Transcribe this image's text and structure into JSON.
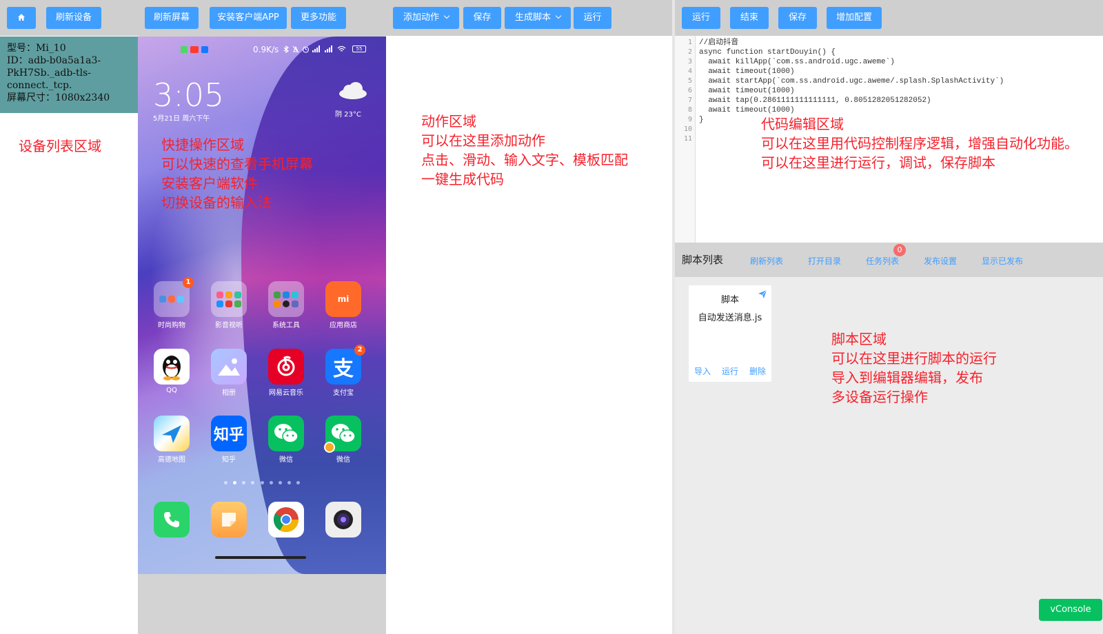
{
  "device_panel": {
    "refresh_label": "刷新设备",
    "device": {
      "model_line": "型号：Mi_10",
      "id_line1": "ID：adb-b0a5a1a3-",
      "id_line2": "PkH7Sb._adb-tls-",
      "id_line3": "connect._tcp.",
      "screen_line": "屏幕尺寸：1080x2340"
    },
    "annotation": "设备列表区域"
  },
  "quick_panel": {
    "buttons": {
      "refresh_screen": "刷新屏幕",
      "install_app": "安装客户端APP",
      "more": "更多功能"
    },
    "annotation": [
      "快捷操作区域",
      "可以快速的查看手机屏幕",
      "安装客户端软件",
      "切换设备的输入法"
    ],
    "phone": {
      "network_speed": "0.9K/s",
      "battery": "55",
      "clock": "3:05",
      "date": "5月21日 周六下午",
      "weather": "阴  23°C",
      "apps_row1": [
        {
          "label": "时尚购物",
          "badge": "1"
        },
        {
          "label": "影音视听",
          "badge": ""
        },
        {
          "label": "系统工具",
          "badge": ""
        },
        {
          "label": "应用商店",
          "badge": ""
        }
      ],
      "apps_row2": [
        {
          "label": "QQ",
          "badge": ""
        },
        {
          "label": "相册",
          "badge": ""
        },
        {
          "label": "网易云音乐",
          "badge": ""
        },
        {
          "label": "支付宝",
          "badge": "2"
        }
      ],
      "apps_row3": [
        {
          "label": "高德地图",
          "badge": ""
        },
        {
          "label": "知乎",
          "badge": ""
        },
        {
          "label": "微信",
          "badge": ""
        },
        {
          "label": "微信",
          "badge": ""
        }
      ],
      "zhihu_icon_text": "知乎",
      "alipay_icon_text": "支",
      "mi_icon_text": "mi"
    }
  },
  "action_panel": {
    "buttons": {
      "add_action": "添加动作",
      "save": "保存",
      "generate": "生成脚本",
      "run": "运行"
    },
    "annotation": [
      "动作区域",
      "可以在这里添加动作",
      "点击、滑动、输入文字、模板匹配",
      "一键生成代码"
    ]
  },
  "editor_panel": {
    "buttons": {
      "run": "运行",
      "stop": "结束",
      "save": "保存",
      "add_config": "增加配置"
    },
    "line_numbers": [
      "1",
      "2",
      "3",
      "4",
      "5",
      "6",
      "7",
      "8",
      "9",
      "10",
      "11"
    ],
    "code_lines": [
      "//启动抖音",
      "async function startDouyin() {",
      "  await killApp(`com.ss.android.ugc.aweme`)",
      "  await timeout(1000)",
      "  await startApp(`com.ss.android.ugc.aweme/.splash.SplashActivity`)",
      "  await timeout(1000)",
      "  await tap(0.2861111111111111, 0.8051282051282052)",
      "  await timeout(1000)",
      "}",
      "",
      ""
    ],
    "annotation": [
      "代码编辑区域",
      "可以在这里用代码控制程序逻辑，增强自动化功能。",
      "可以在这里进行运行，调试，保存脚本"
    ]
  },
  "script_panel": {
    "title": "脚本列表",
    "links": {
      "refresh": "刷新列表",
      "open_dir": "打开目录",
      "tasks": "任务列表",
      "publish_settings": "发布设置",
      "show_published": "显示已发布"
    },
    "task_badge": "0",
    "card": {
      "title": "脚本",
      "name": "自动发送消息.js",
      "import": "导入",
      "run": "运行",
      "delete": "删除"
    },
    "annotation": [
      "脚本区域",
      "可以在这里进行脚本的运行",
      "导入到编辑器编辑，发布",
      "多设备运行操作"
    ]
  },
  "vconsole_label": "vConsole",
  "colors": {
    "primary": "#409eff",
    "annotation": "#f5222d",
    "device_card": "#5f9ea0",
    "vconsole": "#07c160"
  }
}
